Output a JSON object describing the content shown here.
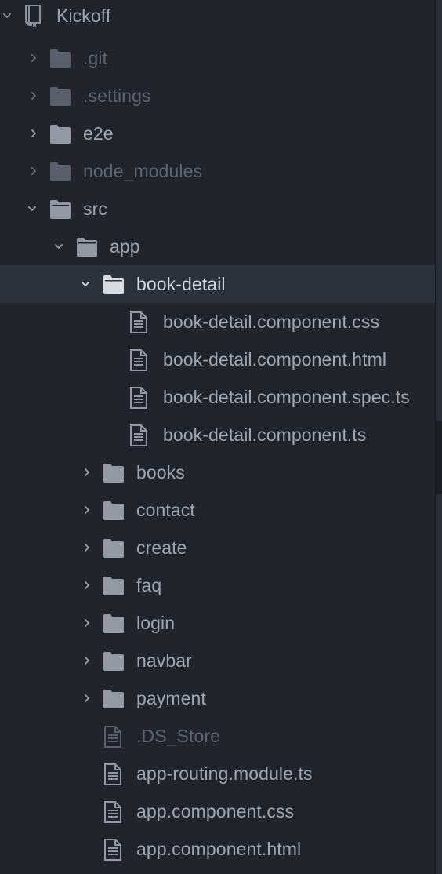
{
  "project": {
    "name": "Kickoff",
    "icon": "repo-book-icon",
    "expanded": true
  },
  "colors": {
    "background": "#21252b",
    "selected_row": "#2c313a",
    "text": "#a0a7b3",
    "text_selected": "#d7dae0",
    "text_ignored": "#5f6570"
  },
  "tree": [
    {
      "label": ".git",
      "type": "folder",
      "expanded": false,
      "ignored": true
    },
    {
      "label": ".settings",
      "type": "folder",
      "expanded": false,
      "ignored": true
    },
    {
      "label": "e2e",
      "type": "folder",
      "expanded": false,
      "ignored": false
    },
    {
      "label": "node_modules",
      "type": "folder",
      "expanded": false,
      "ignored": true
    },
    {
      "label": "src",
      "type": "folder",
      "expanded": true,
      "ignored": false
    },
    {
      "label": "app",
      "type": "folder",
      "expanded": true,
      "ignored": false
    },
    {
      "label": "book-detail",
      "type": "folder",
      "expanded": true,
      "ignored": false,
      "selected": true
    },
    {
      "label": "book-detail.component.css",
      "type": "file"
    },
    {
      "label": "book-detail.component.html",
      "type": "file"
    },
    {
      "label": "book-detail.component.spec.ts",
      "type": "file"
    },
    {
      "label": "book-detail.component.ts",
      "type": "file"
    },
    {
      "label": "books",
      "type": "folder",
      "expanded": false
    },
    {
      "label": "contact",
      "type": "folder",
      "expanded": false
    },
    {
      "label": "create",
      "type": "folder",
      "expanded": false
    },
    {
      "label": "faq",
      "type": "folder",
      "expanded": false
    },
    {
      "label": "login",
      "type": "folder",
      "expanded": false
    },
    {
      "label": "navbar",
      "type": "folder",
      "expanded": false
    },
    {
      "label": "payment",
      "type": "folder",
      "expanded": false
    },
    {
      "label": ".DS_Store",
      "type": "file",
      "ignored": true
    },
    {
      "label": "app-routing.module.ts",
      "type": "file"
    },
    {
      "label": "app.component.css",
      "type": "file"
    },
    {
      "label": "app.component.html",
      "type": "file"
    }
  ]
}
